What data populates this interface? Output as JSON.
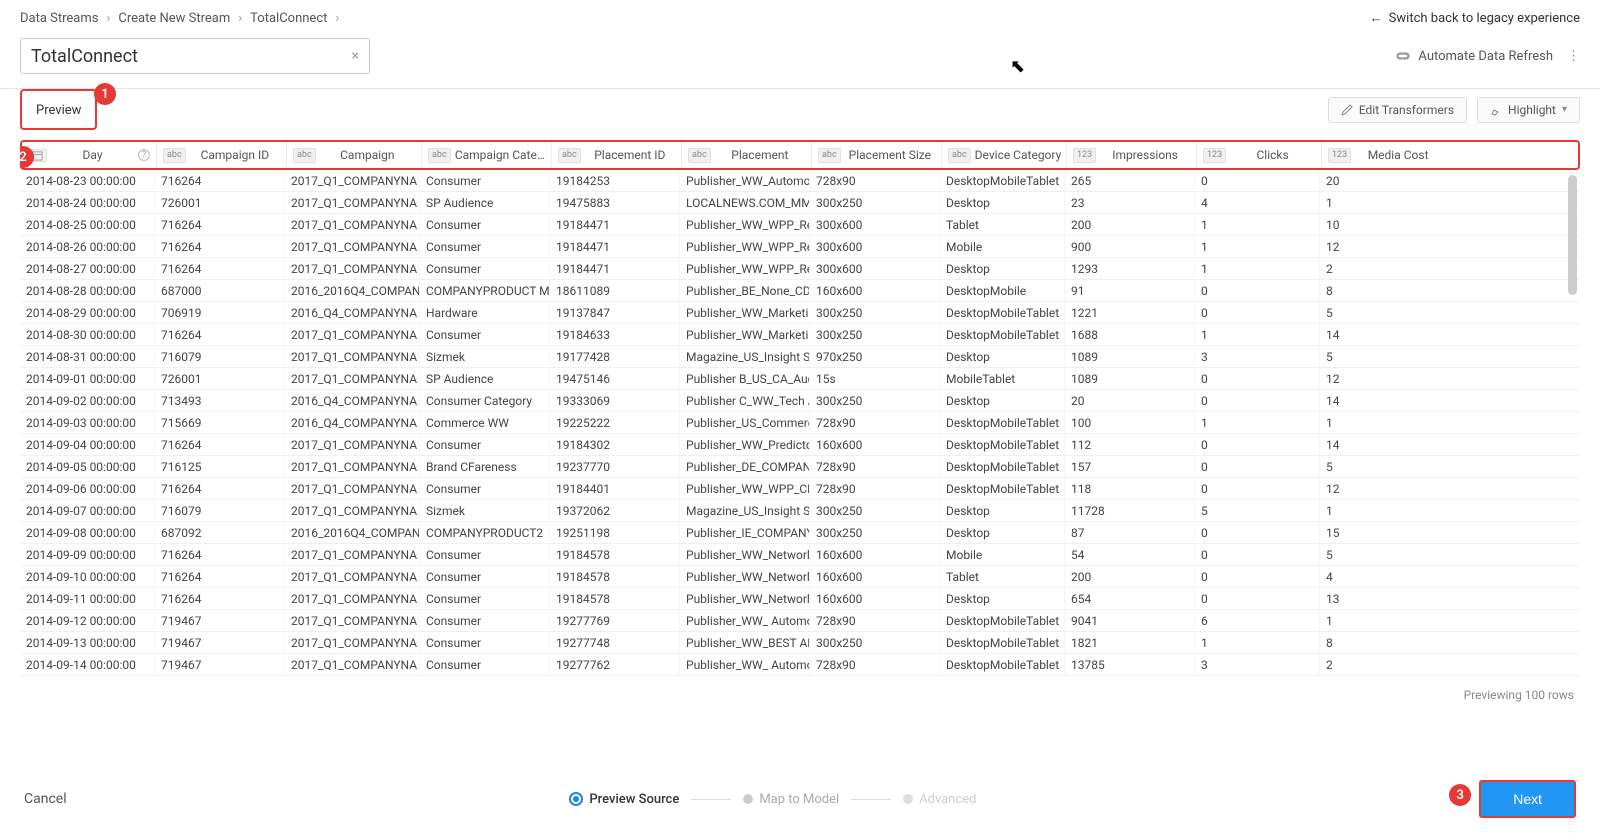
{
  "breadcrumb": [
    "Data Streams",
    "Create New Stream",
    "TotalConnect"
  ],
  "legacy_label": "Switch back to legacy experience",
  "title": "TotalConnect",
  "automate_label": "Automate Data Refresh",
  "tab_preview": "Preview",
  "btn_edit": "Edit Transformers",
  "btn_highlight": "Highlight",
  "columns": [
    {
      "type": "cal",
      "label": "Day",
      "help": true
    },
    {
      "type": "abc",
      "label": "Campaign ID"
    },
    {
      "type": "abc",
      "label": "Campaign"
    },
    {
      "type": "abc",
      "label": "Campaign Cate…"
    },
    {
      "type": "abc",
      "label": "Placement ID"
    },
    {
      "type": "abc",
      "label": "Placement"
    },
    {
      "type": "abc",
      "label": "Placement Size"
    },
    {
      "type": "abc",
      "label": "Device Category"
    },
    {
      "type": "123",
      "label": "Impressions"
    },
    {
      "type": "123",
      "label": "Clicks"
    },
    {
      "type": "123",
      "label": "Media Cost"
    }
  ],
  "rows": [
    [
      "2014-08-23 00:00:00",
      "716264",
      "2017_Q1_COMPANYNA",
      "Consumer",
      "19184253",
      "Publisher_WW_Automo",
      "728x90",
      "DesktopMobileTablet",
      "265",
      "0",
      "20"
    ],
    [
      "2014-08-24 00:00:00",
      "726001",
      "2017_Q1_COMPANYNA",
      "SP Audience",
      "19475883",
      "LOCALNEWS.COM_MM",
      "300x250",
      "Desktop",
      "23",
      "4",
      "1"
    ],
    [
      "2014-08-25 00:00:00",
      "716264",
      "2017_Q1_COMPANYNA",
      "Consumer",
      "19184471",
      "Publisher_WW_WPP_Re",
      "300x600",
      "Tablet",
      "200",
      "1",
      "10"
    ],
    [
      "2014-08-26 00:00:00",
      "716264",
      "2017_Q1_COMPANYNA",
      "Consumer",
      "19184471",
      "Publisher_WW_WPP_Re",
      "300x600",
      "Mobile",
      "900",
      "1",
      "12"
    ],
    [
      "2014-08-27 00:00:00",
      "716264",
      "2017_Q1_COMPANYNA",
      "Consumer",
      "19184471",
      "Publisher_WW_WPP_Re",
      "300x600",
      "Desktop",
      "1293",
      "1",
      "2"
    ],
    [
      "2014-08-28 00:00:00",
      "687000",
      "2016_2016Q4_COMPAN",
      "COMPANYPRODUCT M",
      "18611089",
      "Publisher_BE_None_CD",
      "160x600",
      "DesktopMobile",
      "91",
      "0",
      "8"
    ],
    [
      "2014-08-29 00:00:00",
      "706919",
      "2016_Q4_COMPANYNA",
      "Hardware",
      "19137847",
      "Publisher_WW_Marketi",
      "300x250",
      "DesktopMobileTablet",
      "1221",
      "0",
      "5"
    ],
    [
      "2014-08-30 00:00:00",
      "716264",
      "2017_Q1_COMPANYNA",
      "Consumer",
      "19184633",
      "Publisher_WW_Marketi",
      "300x250",
      "DesktopMobileTablet",
      "1688",
      "1",
      "14"
    ],
    [
      "2014-08-31 00:00:00",
      "716079",
      "2017_Q1_COMPANYNA",
      "Sizmek",
      "19177428",
      "Magazine_US_Insight S",
      "970x250",
      "Desktop",
      "1089",
      "3",
      "5"
    ],
    [
      "2014-09-01 00:00:00",
      "726001",
      "2017_Q1_COMPANYNA",
      "SP Audience",
      "19475146",
      "Publisher B_US_CA_Auc",
      "15s",
      "MobileTablet",
      "1089",
      "0",
      "12"
    ],
    [
      "2014-09-02 00:00:00",
      "713493",
      "2016_Q4_COMPANYNA",
      "Consumer Category",
      "19333069",
      "Publisher C_WW_Tech A",
      "300x250",
      "Desktop",
      "20",
      "0",
      "14"
    ],
    [
      "2014-09-03 00:00:00",
      "715669",
      "2016_Q4_COMPANYNA",
      "Commerce WW",
      "19225222",
      "Publisher_US_Commerc",
      "728x90",
      "DesktopMobileTablet",
      "100",
      "1",
      "1"
    ],
    [
      "2014-09-04 00:00:00",
      "716264",
      "2017_Q1_COMPANYNA",
      "Consumer",
      "19184302",
      "Publisher_WW_Predictc",
      "160x600",
      "DesktopMobileTablet",
      "112",
      "0",
      "14"
    ],
    [
      "2014-09-05 00:00:00",
      "716125",
      "2017_Q1_COMPANYNA",
      "Brand CFareness",
      "19237770",
      "Publisher_DE_COMPAN",
      "728x90",
      "DesktopMobileTablet",
      "157",
      "0",
      "5"
    ],
    [
      "2014-09-06 00:00:00",
      "716264",
      "2017_Q1_COMPANYNA",
      "Consumer",
      "19184401",
      "Publisher_WW_WPP_CD",
      "728x90",
      "DesktopMobileTablet",
      "118",
      "0",
      "12"
    ],
    [
      "2014-09-07 00:00:00",
      "716079",
      "2017_Q1_COMPANYNA",
      "Sizmek",
      "19372062",
      "Magazine_US_Insight S",
      "300x250",
      "Desktop",
      "11728",
      "5",
      "1"
    ],
    [
      "2014-09-08 00:00:00",
      "687092",
      "2016_2016Q4_COMPAN",
      "COMPANYPRODUCT2",
      "19251198",
      "Publisher_IE_COMPANY",
      "300x250",
      "Desktop",
      "87",
      "0",
      "15"
    ],
    [
      "2014-09-09 00:00:00",
      "716264",
      "2017_Q1_COMPANYNA",
      "Consumer",
      "19184578",
      "Publisher_WW_Networl",
      "160x600",
      "Mobile",
      "54",
      "0",
      "5"
    ],
    [
      "2014-09-10 00:00:00",
      "716264",
      "2017_Q1_COMPANYNA",
      "Consumer",
      "19184578",
      "Publisher_WW_Networl",
      "160x600",
      "Tablet",
      "200",
      "0",
      "4"
    ],
    [
      "2014-09-11 00:00:00",
      "716264",
      "2017_Q1_COMPANYNA",
      "Consumer",
      "19184578",
      "Publisher_WW_Networl",
      "160x600",
      "Desktop",
      "654",
      "0",
      "13"
    ],
    [
      "2014-09-12 00:00:00",
      "719467",
      "2017_Q1_COMPANYNA",
      "Consumer",
      "19277769",
      "Publisher_WW_ Automo",
      "728x90",
      "DesktopMobileTablet",
      "9041",
      "6",
      "1"
    ],
    [
      "2014-09-13 00:00:00",
      "719467",
      "2017_Q1_COMPANYNA",
      "Consumer",
      "19277748",
      "Publisher_WW_BEST AL",
      "300x250",
      "DesktopMobileTablet",
      "1821",
      "1",
      "8"
    ],
    [
      "2014-09-14 00:00:00",
      "719467",
      "2017_Q1_COMPANYNA",
      "Consumer",
      "19277762",
      "Publisher_WW_ Automo",
      "728x90",
      "DesktopMobileTablet",
      "13785",
      "3",
      "2"
    ]
  ],
  "preview_note": "Previewing 100 rows",
  "footer": {
    "cancel": "Cancel",
    "steps": [
      "Preview Source",
      "Map to Model",
      "Advanced"
    ],
    "next": "Next"
  },
  "annotations": {
    "a1": "1",
    "a2": "2",
    "a3": "3"
  }
}
